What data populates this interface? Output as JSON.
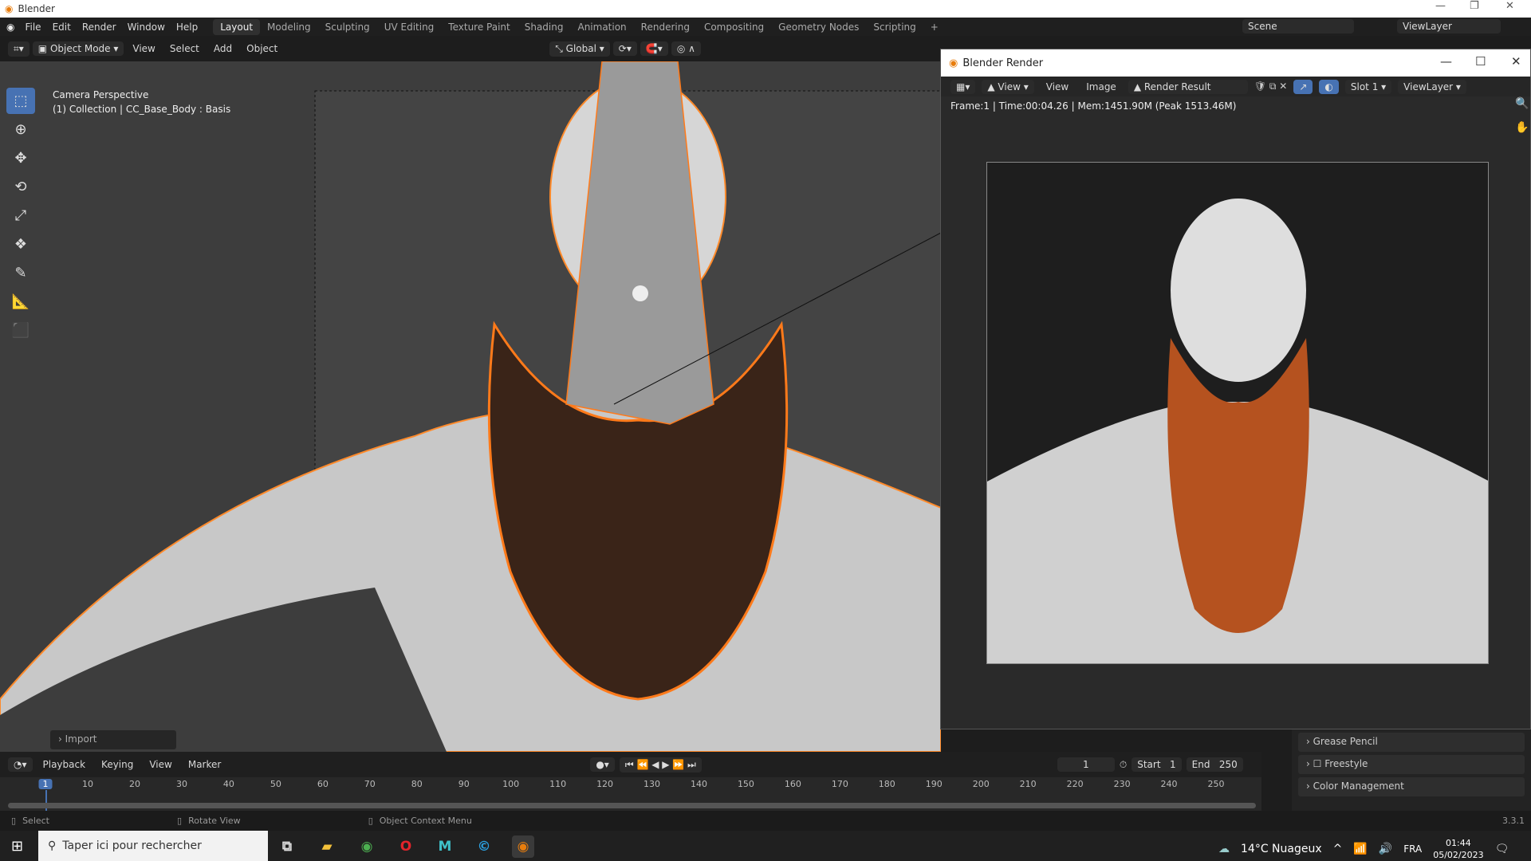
{
  "app": {
    "title": "Blender",
    "version": "3.3.1"
  },
  "menu": [
    "File",
    "Edit",
    "Render",
    "Window",
    "Help"
  ],
  "workspaces": [
    "Layout",
    "Modeling",
    "Sculpting",
    "UV Editing",
    "Texture Paint",
    "Shading",
    "Animation",
    "Rendering",
    "Compositing",
    "Geometry Nodes",
    "Scripting",
    "+"
  ],
  "scene": {
    "scene_name": "Scene",
    "view_layer": "ViewLayer"
  },
  "viewport_header": {
    "mode": "Object Mode",
    "menus": [
      "View",
      "Select",
      "Add",
      "Object"
    ],
    "orientation": "Global"
  },
  "viewport": {
    "line1": "Camera Perspective",
    "line2": "(1) Collection | CC_Base_Body : Basis",
    "import_panel": "Import"
  },
  "render_window": {
    "title": "Blender Render",
    "menus": [
      "View",
      "View",
      "Image"
    ],
    "image_name": "Render Result",
    "slot": "Slot 1",
    "view_layer": "ViewLayer",
    "info": "Frame:1 | Time:00:04.26 | Mem:1451.90M (Peak 1513.46M)"
  },
  "properties": {
    "panels": [
      "Grease Pencil",
      "Freestyle",
      "Color Management"
    ]
  },
  "timeline": {
    "menus": [
      "Playback",
      "Keying",
      "View",
      "Marker"
    ],
    "current_frame": "1",
    "start_label": "Start",
    "start": "1",
    "end_label": "End",
    "end": "250",
    "ticks": [
      "1",
      "10",
      "20",
      "30",
      "40",
      "50",
      "60",
      "70",
      "80",
      "90",
      "100",
      "110",
      "120",
      "130",
      "140",
      "150",
      "160",
      "170",
      "180",
      "190",
      "200",
      "210",
      "220",
      "230",
      "240",
      "250"
    ]
  },
  "statusbar": {
    "items": [
      "Select",
      "Rotate View",
      "Object Context Menu"
    ]
  },
  "taskbar": {
    "search_placeholder": "Taper ici pour rechercher",
    "weather": "14°C  Nuageux",
    "lang": "FRA",
    "time": "01:44",
    "date": "05/02/2023"
  },
  "colors": {
    "accent": "#4772b3",
    "selection": "#ff7a1a"
  }
}
